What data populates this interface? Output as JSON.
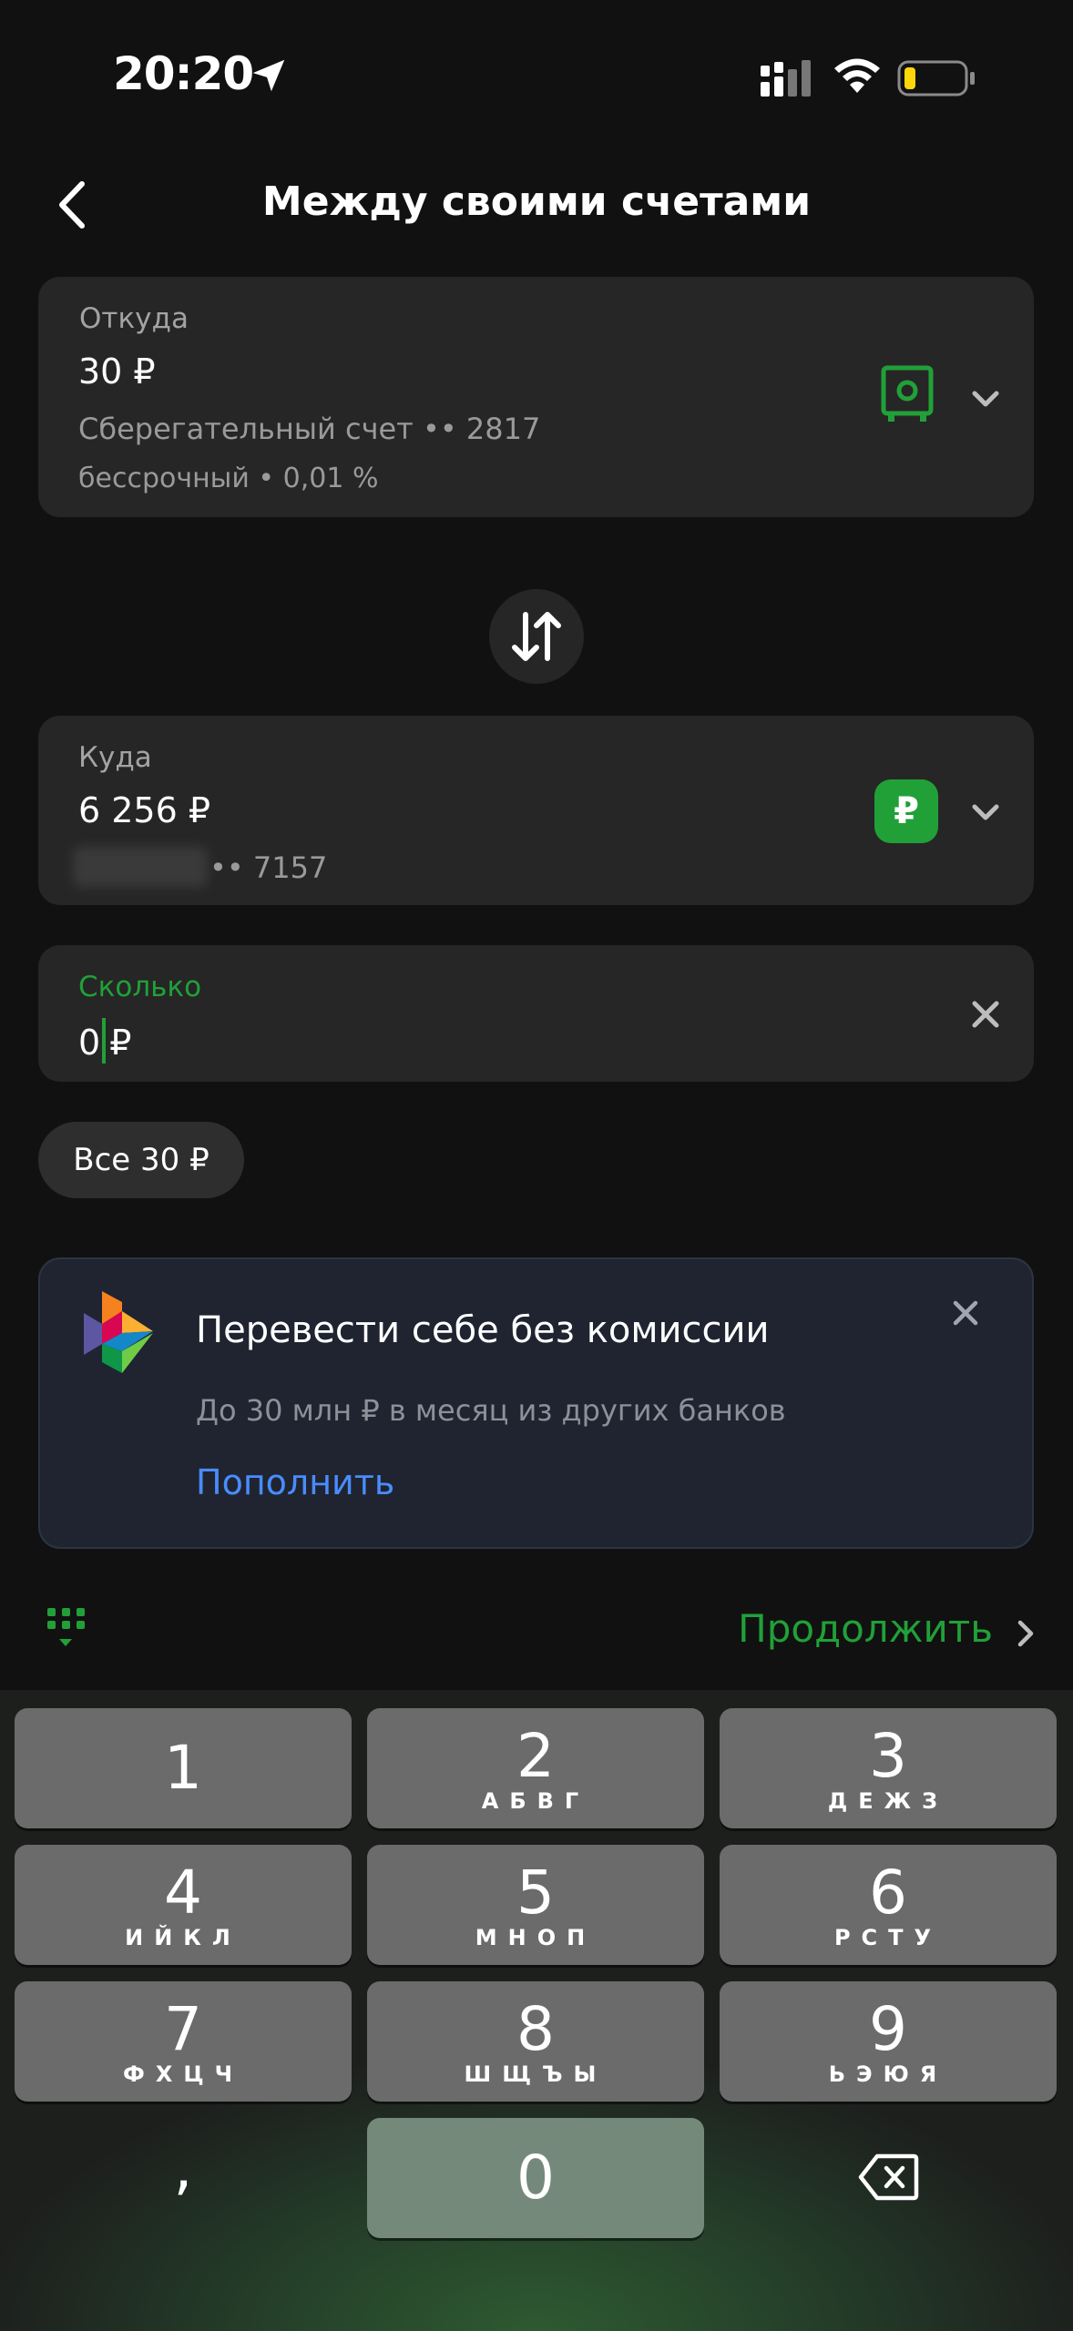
{
  "status_bar": {
    "time": "20:20"
  },
  "nav": {
    "title": "Между своими счетами"
  },
  "from": {
    "label": "Откуда",
    "amount": "30 ₽",
    "account": "Сберегательный счет •• 2817",
    "details": "бессрочный • 0,01 %"
  },
  "to": {
    "label": "Куда",
    "amount": "6 256 ₽",
    "account_suffix": "•• 7157",
    "badge": "₽"
  },
  "amount_field": {
    "label": "Сколько",
    "value": "0",
    "currency": "₽"
  },
  "all_button": "Все 30 ₽",
  "promo": {
    "title": "Перевести себе без комиссии",
    "text": "До 30 млн ₽ в месяц из других банков",
    "link": "Пополнить"
  },
  "continue_label": "Продолжить",
  "keyboard": {
    "keys": [
      {
        "num": "1",
        "letters": ""
      },
      {
        "num": "2",
        "letters": "АБВГ"
      },
      {
        "num": "3",
        "letters": "ДЕЖЗ"
      },
      {
        "num": "4",
        "letters": "ИЙКЛ"
      },
      {
        "num": "5",
        "letters": "МНОП"
      },
      {
        "num": "6",
        "letters": "РСТУ"
      },
      {
        "num": "7",
        "letters": "ФХЦЧ"
      },
      {
        "num": "8",
        "letters": "ШЩЪЫ"
      },
      {
        "num": "9",
        "letters": "ЬЭЮЯ"
      }
    ],
    "comma": ",",
    "zero": "0"
  },
  "colors": {
    "accent": "#21a038",
    "link": "#4a8cff",
    "background": "#111111",
    "card": "#262626"
  }
}
